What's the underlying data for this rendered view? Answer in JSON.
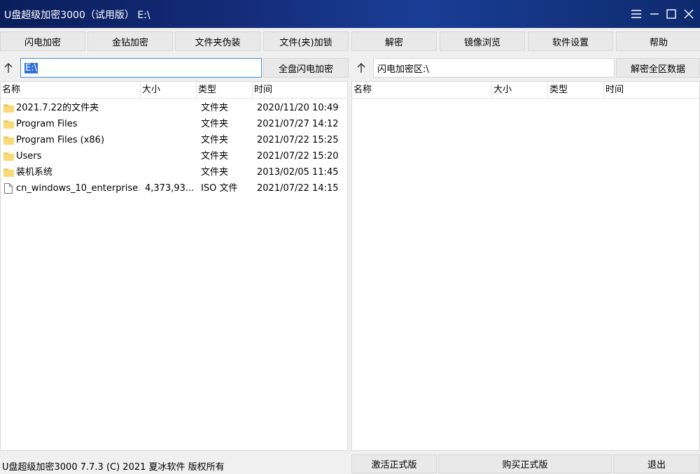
{
  "window": {
    "title": "U盘超级加密3000（试用版）  E:\\",
    "controls": [
      "menu-icon",
      "minimize-icon",
      "maximize-icon",
      "close-icon"
    ]
  },
  "toolbar": {
    "buttons": [
      {
        "label": "闪电加密"
      },
      {
        "label": "金钻加密"
      },
      {
        "label": "文件夹伪装"
      },
      {
        "label": "文件(夹)加锁"
      },
      {
        "label": "解密"
      },
      {
        "label": "镜像浏览"
      },
      {
        "label": "软件设置"
      },
      {
        "label": "帮助"
      }
    ]
  },
  "left": {
    "path_value": "E:\\",
    "action_label": "全盘闪电加密",
    "columns": [
      "名称",
      "大小",
      "类型",
      "时间"
    ],
    "rows": [
      {
        "name": "2021.7.22的文件夹",
        "size": "",
        "type": "文件夹",
        "time": "2020/11/20 10:49",
        "icon": "folder-icon"
      },
      {
        "name": "Program Files",
        "size": "",
        "type": "文件夹",
        "time": "2021/07/27 14:12",
        "icon": "folder-icon"
      },
      {
        "name": "Program Files (x86)",
        "size": "",
        "type": "文件夹",
        "time": "2021/07/22 15:25",
        "icon": "folder-icon"
      },
      {
        "name": "Users",
        "size": "",
        "type": "文件夹",
        "time": "2021/07/22 15:20",
        "icon": "folder-icon"
      },
      {
        "name": "装机系统",
        "size": "",
        "type": "文件夹",
        "time": "2013/02/05 11:45",
        "icon": "folder-icon"
      },
      {
        "name": "cn_windows_10_enterprise...",
        "size": "4,373,93...",
        "type": "ISO 文件",
        "time": "2021/07/22 14:15",
        "icon": "file-icon"
      }
    ]
  },
  "right": {
    "path_value": "闪电加密区:\\",
    "action_label": "解密全区数据",
    "columns": [
      "名称",
      "大小",
      "类型",
      "时间"
    ],
    "rows": []
  },
  "statusbar": {
    "text": "U盘超级加密3000 7.7.3 (C) 2021 夏冰软件 版权所有",
    "activate_label": "激活正式版",
    "buy_label": "购买正式版",
    "exit_label": "退出"
  }
}
